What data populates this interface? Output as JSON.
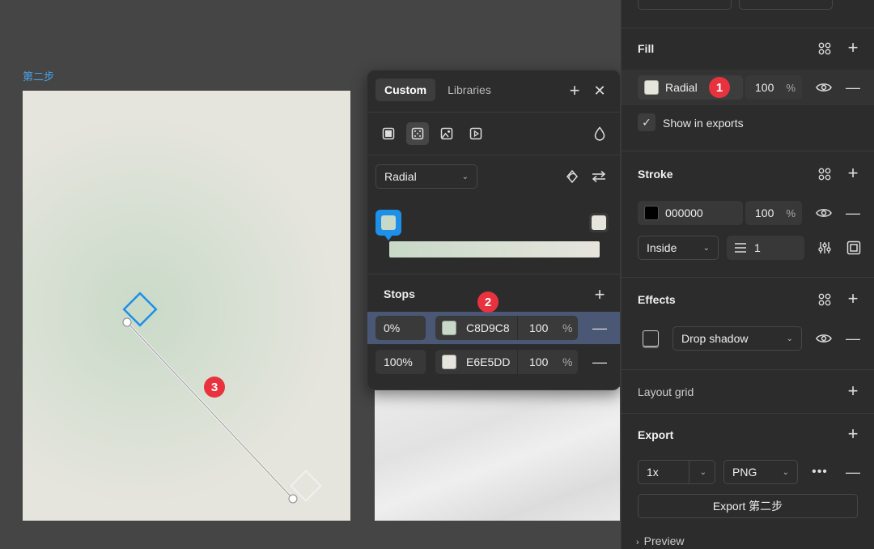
{
  "canvas": {
    "frame_label": "第二步"
  },
  "badges": {
    "one": "1",
    "two": "2",
    "three": "3"
  },
  "picker": {
    "tabs": [
      {
        "label": "Custom"
      },
      {
        "label": "Libraries"
      }
    ],
    "gradient_type": "Radial",
    "stops_title": "Stops",
    "stops": [
      {
        "position": "0%",
        "hex": "C8D9C8",
        "opacity": "100",
        "unit": "%",
        "color": "#c8d9c8"
      },
      {
        "position": "100%",
        "hex": "E6E5DD",
        "opacity": "100",
        "unit": "%",
        "color": "#e6e5dd"
      }
    ]
  },
  "panel": {
    "fill": {
      "title": "Fill",
      "type_label": "Radial",
      "opacity": "100",
      "unit": "%",
      "show_in_exports": "Show in exports"
    },
    "stroke": {
      "title": "Stroke",
      "hex": "000000",
      "opacity": "100",
      "unit": "%",
      "position": "Inside",
      "weight": "1"
    },
    "effects": {
      "title": "Effects",
      "type": "Drop shadow"
    },
    "layout_grid": {
      "title": "Layout grid"
    },
    "export": {
      "title": "Export",
      "scale": "1x",
      "format": "PNG",
      "button_label": "Export 第二步",
      "preview": "Preview"
    }
  },
  "colors": {
    "accent": "#1e90e8",
    "badge": "#e8333f",
    "selected_stop": "#4a5775"
  }
}
